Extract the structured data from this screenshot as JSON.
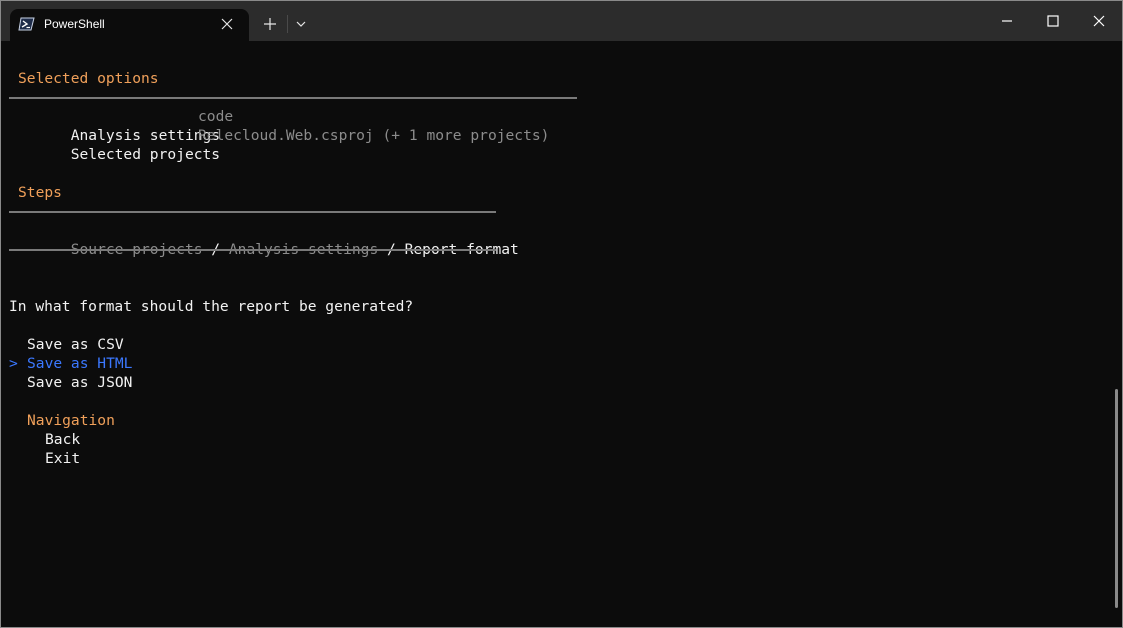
{
  "window": {
    "tab_title": "PowerShell",
    "icons": {
      "app": "powershell-icon",
      "close_tab": "close-icon",
      "new_tab": "plus-icon",
      "dropdown": "chevron-down-icon",
      "minimize": "minimize-icon",
      "maximize": "maximize-icon",
      "close_window": "close-icon"
    }
  },
  "selected_options": {
    "heading": "Selected options",
    "rows": [
      {
        "label": "Analysis settings",
        "value": "code"
      },
      {
        "label": "Selected projects",
        "value": "Relecloud.Web.csproj (+ 1 more projects)"
      }
    ]
  },
  "steps": {
    "heading": "Steps",
    "items": [
      "Source projects",
      "Analysis settings",
      "Report format"
    ],
    "separator": " / ",
    "current_index": 2
  },
  "prompt": {
    "question": "In what format should the report be generated?",
    "cursor": ">",
    "options": [
      "Save as CSV",
      "Save as HTML",
      "Save as JSON"
    ],
    "selected_index": 1
  },
  "navigation": {
    "heading": "Navigation",
    "items": [
      "Back",
      "Exit"
    ]
  },
  "colors": {
    "heading": "#f0a05a",
    "selected": "#3b78ff",
    "text": "#cccccc",
    "dim": "#8c8c8c",
    "background": "#0c0c0c"
  }
}
